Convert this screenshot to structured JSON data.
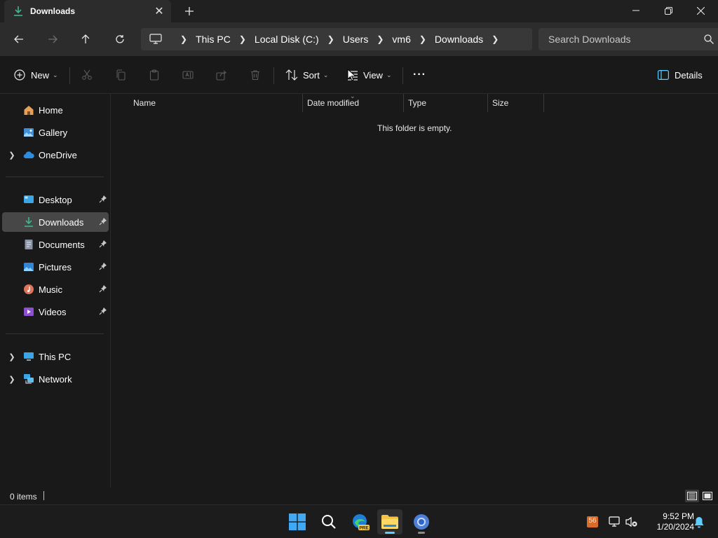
{
  "tab": {
    "title": "Downloads"
  },
  "address": {
    "crumbs": [
      "This PC",
      "Local Disk (C:)",
      "Users",
      "vm6",
      "Downloads"
    ]
  },
  "search": {
    "placeholder": "Search Downloads"
  },
  "commands": {
    "new_label": "New",
    "sort_label": "Sort",
    "view_label": "View",
    "more_label": "···",
    "details_label": "Details"
  },
  "nav": {
    "home": "Home",
    "gallery": "Gallery",
    "onedrive": "OneDrive",
    "desktop": "Desktop",
    "downloads": "Downloads",
    "documents": "Documents",
    "pictures": "Pictures",
    "music": "Music",
    "videos": "Videos",
    "this_pc": "This PC",
    "network": "Network"
  },
  "columns": {
    "name": "Name",
    "date": "Date modified",
    "type": "Type",
    "size": "Size"
  },
  "content": {
    "empty_message": "This folder is empty."
  },
  "status": {
    "count": "0 items"
  },
  "tray": {
    "badge": "56",
    "time": "9:52 PM",
    "date": "1/20/2024"
  },
  "taskbar": {
    "edge_badge": "PRE"
  },
  "colors": {
    "accent": "#60cdff",
    "selected_bg": "#474747",
    "folder": "#f5c444"
  }
}
